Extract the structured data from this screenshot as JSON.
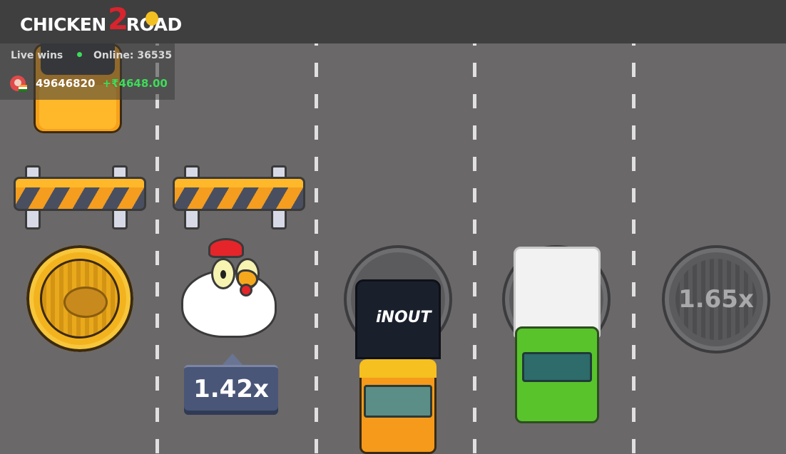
{
  "header": {
    "logo_text_a": "CHICKEN",
    "logo_text_two": "2",
    "logo_text_b": "ROAD"
  },
  "live_wins": {
    "label": "Live wins",
    "online_label": "Online: 36535",
    "entry": {
      "user_id": "49646820",
      "amount": "+₹4648.00"
    }
  },
  "game": {
    "current_multiplier": "1.42x",
    "next_manhole_multiplier": "1.65x",
    "truck_brand": "iNOUT"
  },
  "colors": {
    "road": "#6b6869",
    "topbar": "#3f3f3f",
    "accent_red": "#d9232d",
    "win_green": "#3ddc5a",
    "badge_blue": "#4a5677",
    "manhole_gold": "#f2b31f"
  }
}
